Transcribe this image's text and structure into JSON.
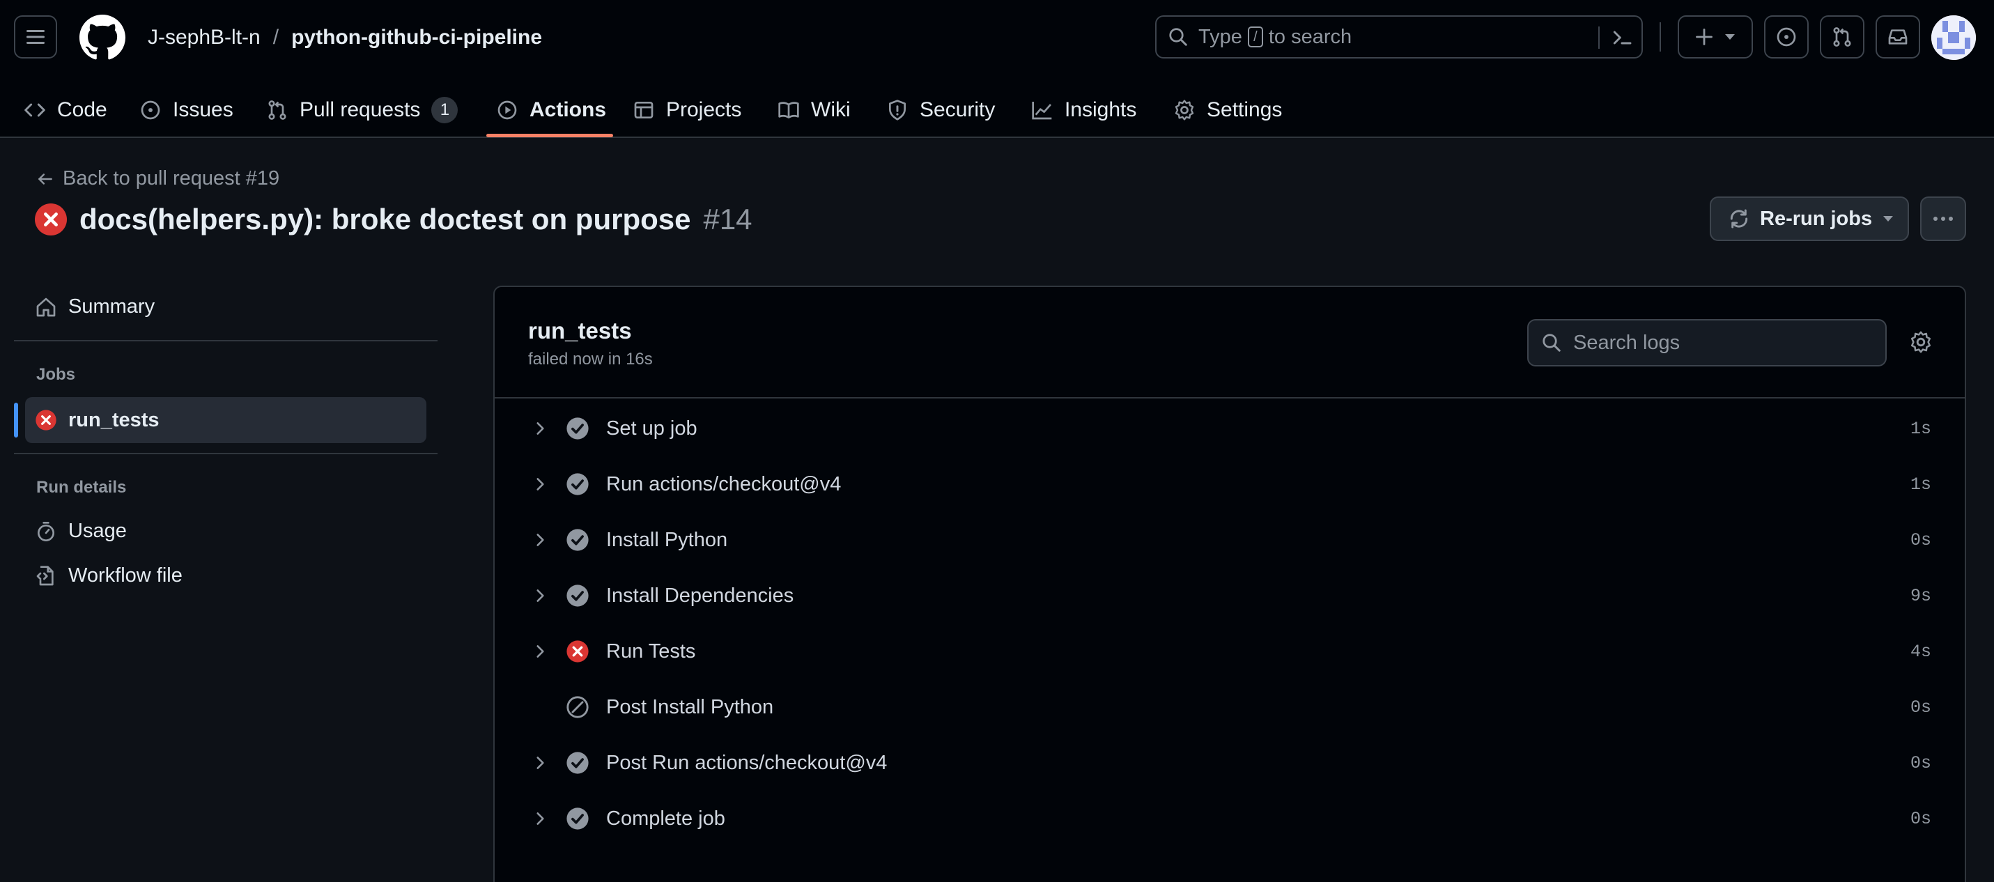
{
  "repo": {
    "owner": "J-sephB-lt-n",
    "separator": "/",
    "name": "python-github-ci-pipeline"
  },
  "search": {
    "prefix": "Type",
    "key": "/",
    "suffix": "to search"
  },
  "nav": {
    "code": "Code",
    "issues": "Issues",
    "pulls": "Pull requests",
    "pulls_count": "1",
    "actions": "Actions",
    "projects": "Projects",
    "wiki": "Wiki",
    "security": "Security",
    "insights": "Insights",
    "settings": "Settings"
  },
  "run": {
    "back_link": "Back to pull request #19",
    "title": "docs(helpers.py): broke doctest on purpose",
    "number": "#14",
    "status": "failed",
    "rerun_label": "Re-run jobs"
  },
  "sidebar": {
    "summary": "Summary",
    "jobs_heading": "Jobs",
    "job": "run_tests",
    "details_heading": "Run details",
    "usage": "Usage",
    "workflow_file": "Workflow file"
  },
  "job": {
    "name": "run_tests",
    "status_text": "failed now in 16s",
    "search_placeholder": "Search logs",
    "steps": [
      {
        "label": "Set up job",
        "duration": "1s",
        "status": "success",
        "expandable": true
      },
      {
        "label": "Run actions/checkout@v4",
        "duration": "1s",
        "status": "success",
        "expandable": true
      },
      {
        "label": "Install Python",
        "duration": "0s",
        "status": "success",
        "expandable": true
      },
      {
        "label": "Install Dependencies",
        "duration": "9s",
        "status": "success",
        "expandable": true
      },
      {
        "label": "Run Tests",
        "duration": "4s",
        "status": "failure",
        "expandable": true
      },
      {
        "label": "Post Install Python",
        "duration": "0s",
        "status": "skipped",
        "expandable": false
      },
      {
        "label": "Post Run actions/checkout@v4",
        "duration": "0s",
        "status": "success",
        "expandable": true
      },
      {
        "label": "Complete job",
        "duration": "0s",
        "status": "success",
        "expandable": true
      }
    ]
  },
  "colors": {
    "accent_underline": "#f78166",
    "failure": "#da3633",
    "success_icon": "#9198a1",
    "active_marker": "#4493f8"
  }
}
